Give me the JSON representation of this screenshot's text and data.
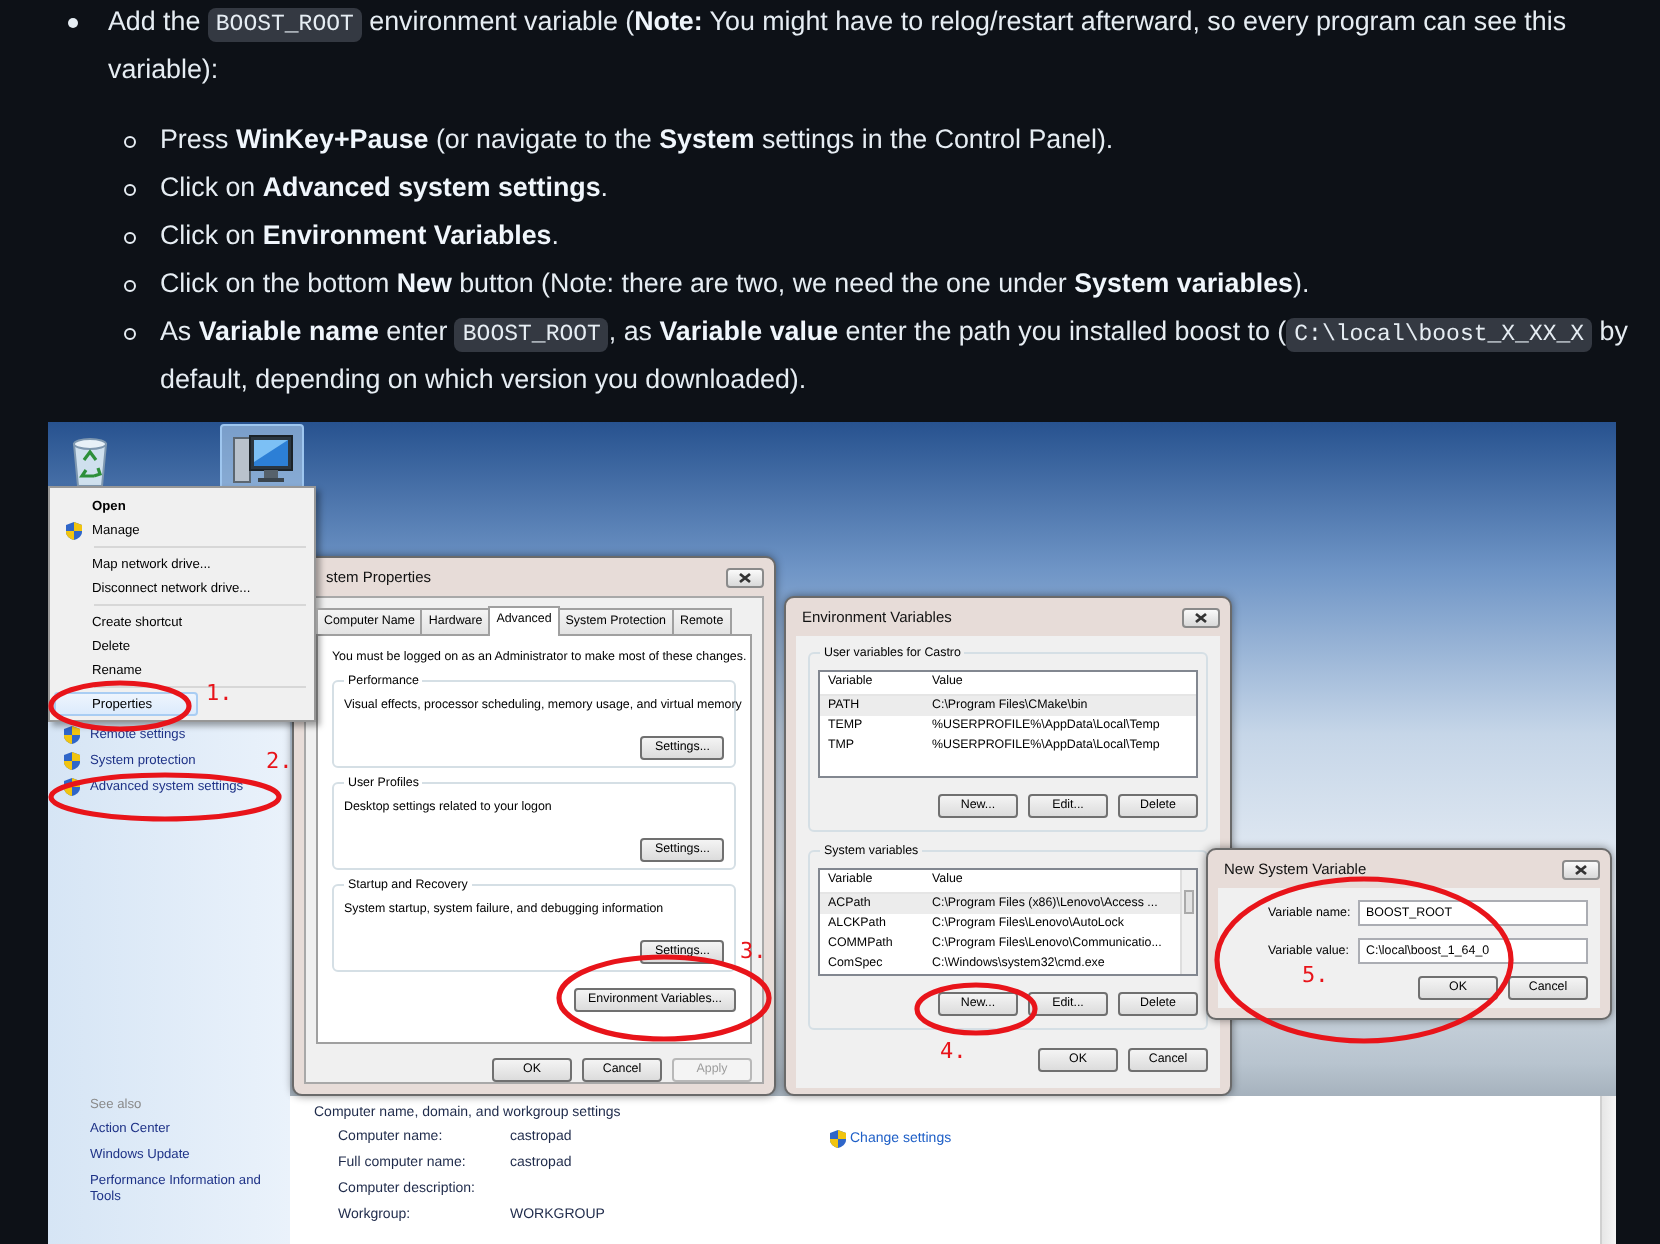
{
  "intro": {
    "segments": [
      {
        "kind": "text",
        "text": "Add the "
      },
      {
        "kind": "code",
        "text": "BOOST_ROOT"
      },
      {
        "kind": "text",
        "text": " environment variable (**Note:** You might have to relog/restart afterward, so every program can see this variable):"
      }
    ]
  },
  "steps": [
    {
      "segments": [
        {
          "kind": "text",
          "text": "Press **WinKey+Pause** (or navigate to the **System** settings in the Control Panel)."
        }
      ]
    },
    {
      "segments": [
        {
          "kind": "text",
          "text": "Click on **Advanced system settings**."
        }
      ]
    },
    {
      "segments": [
        {
          "kind": "text",
          "text": "Click on **Environment Variables**."
        }
      ]
    },
    {
      "segments": [
        {
          "kind": "text",
          "text": "Click on the bottom **New** button (Note: there are two, we need the one under **System variables**)."
        }
      ]
    },
    {
      "segments": [
        {
          "kind": "text",
          "text": "As **Variable name** enter "
        },
        {
          "kind": "code",
          "text": "BOOST_ROOT"
        },
        {
          "kind": "text",
          "text": ", as **Variable value** enter the path you installed boost to ("
        },
        {
          "kind": "code",
          "text": "C:\\local\\boost_X_XX_X"
        },
        {
          "kind": "text",
          "text": " by default, depending on which version you downloaded)."
        }
      ]
    }
  ],
  "screenshot": {
    "desktop_icons": [
      {
        "kind": "recycle-bin",
        "selected": false
      },
      {
        "kind": "computer",
        "selected": true
      }
    ],
    "context_menu": {
      "items": [
        {
          "kind": "item",
          "label": "Open",
          "default": true,
          "shield": false,
          "selected": false
        },
        {
          "kind": "item",
          "label": "Manage",
          "default": false,
          "shield": true,
          "selected": false
        },
        {
          "kind": "separator"
        },
        {
          "kind": "item",
          "label": "Map network drive...",
          "default": false,
          "shield": false,
          "selected": false
        },
        {
          "kind": "item",
          "label": "Disconnect network drive...",
          "default": false,
          "shield": false,
          "selected": false
        },
        {
          "kind": "separator"
        },
        {
          "kind": "item",
          "label": "Create shortcut",
          "default": false,
          "shield": false,
          "selected": false
        },
        {
          "kind": "item",
          "label": "Delete",
          "default": false,
          "shield": false,
          "selected": false
        },
        {
          "kind": "item",
          "label": "Rename",
          "default": false,
          "shield": false,
          "selected": false
        },
        {
          "kind": "separator"
        },
        {
          "kind": "item",
          "label": "Properties",
          "default": false,
          "shield": false,
          "selected": true
        }
      ]
    },
    "control_panel": {
      "tasks": [
        "Remote settings",
        "System protection",
        "Advanced system settings"
      ],
      "see_also_title": "See also",
      "see_also": [
        "Action Center",
        "Windows Update",
        "Performance Information and Tools"
      ],
      "section_title": "Computer name, domain, and workgroup settings",
      "fields": [
        {
          "label": "Computer name:",
          "value": "castropad"
        },
        {
          "label": "Full computer name:",
          "value": "castropad"
        },
        {
          "label": "Computer description:"
        },
        {
          "label": "Workgroup:",
          "value": "WORKGROUP"
        }
      ],
      "link": "Change settings"
    },
    "system_properties": {
      "title": "stem Properties",
      "tabs": [
        {
          "label": "Computer Name",
          "selected": false
        },
        {
          "label": "Hardware",
          "selected": false
        },
        {
          "label": "Advanced",
          "selected": true
        },
        {
          "label": "System Protection",
          "selected": false
        },
        {
          "label": "Remote",
          "selected": false
        }
      ],
      "notice": "You must be logged on as an Administrator to make most of these changes.",
      "groups": [
        {
          "title": "Performance",
          "description": "Visual effects, processor scheduling, memory usage, and virtual memory",
          "button": "Settings..."
        },
        {
          "title": "User Profiles",
          "description": "Desktop settings related to your logon",
          "button": "Settings..."
        },
        {
          "title": "Startup and Recovery",
          "description": "System startup, system failure, and debugging information",
          "button": "Settings..."
        }
      ],
      "env_button": "Environment Variables...",
      "buttons": [
        {
          "label": "OK",
          "disabled": false
        },
        {
          "label": "Cancel",
          "disabled": false
        },
        {
          "label": "Apply",
          "disabled": true
        }
      ]
    },
    "environment_variables": {
      "title": "Environment Variables",
      "groups": [
        {
          "title": "User variables for Castro",
          "columns": [
            "Variable",
            "Value"
          ],
          "rows": [
            {
              "variable": "PATH",
              "value": "C:\\Program Files\\CMake\\bin",
              "selected": true
            },
            {
              "variable": "TEMP",
              "value": "%USERPROFILE%\\AppData\\Local\\Temp",
              "selected": false
            },
            {
              "variable": "TMP",
              "value": "%USERPROFILE%\\AppData\\Local\\Temp",
              "selected": false
            }
          ],
          "buttons": [
            "New...",
            "Edit...",
            "Delete"
          ]
        },
        {
          "title": "System variables",
          "columns": [
            "Variable",
            "Value"
          ],
          "rows": [
            {
              "variable": "ACPath",
              "value": "C:\\Program Files (x86)\\Lenovo\\Access ...",
              "selected": true
            },
            {
              "variable": "ALCKPath",
              "value": "C:\\Program Files\\Lenovo\\AutoLock",
              "selected": false
            },
            {
              "variable": "COMMPath",
              "value": "C:\\Program Files\\Lenovo\\Communicatio...",
              "selected": false
            },
            {
              "variable": "ComSpec",
              "value": "C:\\Windows\\system32\\cmd.exe",
              "selected": false
            }
          ],
          "buttons": [
            "New...",
            "Edit...",
            "Delete"
          ]
        }
      ],
      "buttons": [
        "OK",
        "Cancel"
      ]
    },
    "new_variable": {
      "title": "New System Variable",
      "fields": [
        {
          "label": "Variable name:",
          "value": "BOOST_ROOT"
        },
        {
          "label": "Variable value:",
          "value": "C:\\local\\boost_1_64_0"
        }
      ],
      "buttons": [
        "OK",
        "Cancel"
      ]
    },
    "annotations": [
      {
        "label": "1."
      },
      {
        "label": "2."
      },
      {
        "label": "3."
      },
      {
        "label": "4."
      },
      {
        "label": "5."
      }
    ]
  }
}
